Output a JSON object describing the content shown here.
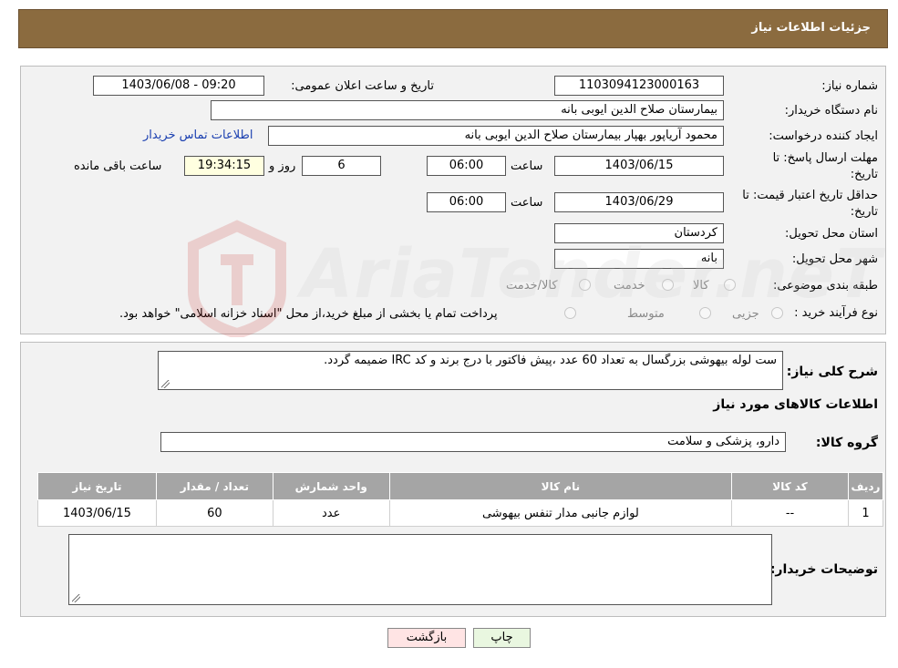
{
  "header": {
    "title": "جزئیات اطلاعات نیاز"
  },
  "form": {
    "need_number_label": "شماره نیاز:",
    "need_number": "1103094123000163",
    "announce_label": "تاریخ و ساعت اعلان عمومی:",
    "announce_value": "1403/06/08 - 09:20",
    "buyer_org_label": "نام دستگاه خریدار:",
    "buyer_org": "بیمارستان صلاح الدین ایوبی بانه",
    "creator_label": "ایجاد کننده درخواست:",
    "creator": "محمود آریاپور بهپار بیمارستان صلاح الدین ایوبی بانه",
    "contact_link": "اطلاعات تماس خریدار",
    "reply_deadline_label_1": "مهلت ارسال پاسخ: تا",
    "reply_deadline_label_2": "تاریخ:",
    "reply_date": "1403/06/15",
    "time_label": "ساعت",
    "reply_time": "06:00",
    "days_value": "6",
    "days_label": "روز و",
    "remaining_time": "19:34:15",
    "remaining_label": "ساعت باقی مانده",
    "validity_label_1": "حداقل تاریخ اعتبار قیمت: تا",
    "validity_label_2": "تاریخ:",
    "validity_date": "1403/06/29",
    "validity_time": "06:00",
    "province_label": "استان محل تحویل:",
    "province": "کردستان",
    "city_label": "شهر محل تحویل:",
    "city": "بانه",
    "category_label": "طبقه بندی موضوعی:",
    "category_options": [
      "کالا",
      "خدمت",
      "کالا/خدمت"
    ],
    "process_label": "نوع فرآیند خرید :",
    "process_options": [
      "جزیی",
      "متوسط"
    ],
    "process_note": "پرداخت تمام یا بخشی از مبلغ خرید،از محل \"اسناد خزانه اسلامی\" خواهد بود."
  },
  "details": {
    "description_label": "شرح کلی نیاز:",
    "description": "ست لوله بیهوشی بزرگسال به تعداد 60 عدد ،پیش فاکتور با درج برند و کد IRC ضمیمه گردد.",
    "items_heading": "اطلاعات کالاهای مورد نیاز",
    "group_label": "گروه کالا:",
    "group_value": "دارو، پزشکی و سلامت",
    "table_headers": [
      "ردیف",
      "کد کالا",
      "نام کالا",
      "واحد شمارش",
      "تعداد / مقدار",
      "تاریخ نیاز"
    ],
    "table_rows": [
      [
        "1",
        "--",
        "لوازم جانبی مدار تنفس بیهوشی",
        "عدد",
        "60",
        "1403/06/15"
      ]
    ],
    "buyer_notes_label": "توضیحات خریدار:"
  },
  "buttons": {
    "print": "چاپ",
    "back": "بازگشت"
  },
  "watermark": {
    "text": "AriaTender.neT"
  }
}
